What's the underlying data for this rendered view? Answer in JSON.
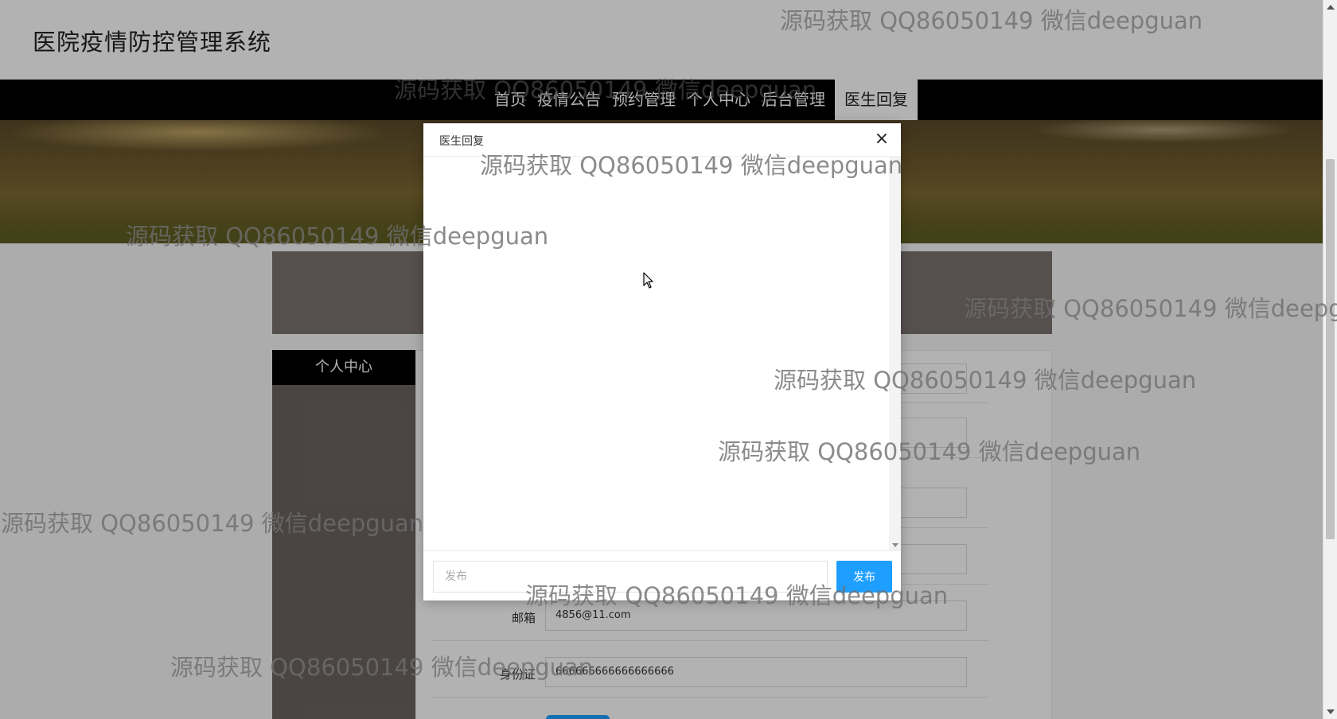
{
  "site": {
    "title": "医院疫情防控管理系统"
  },
  "nav": {
    "items": [
      {
        "label": "首页"
      },
      {
        "label": "疫情公告"
      },
      {
        "label": "预约管理"
      },
      {
        "label": "个人中心"
      },
      {
        "label": "后台管理"
      },
      {
        "label": "医生回复",
        "active": true
      }
    ]
  },
  "sidebar": {
    "title": "个人中心"
  },
  "form": {
    "email_label": "邮箱",
    "email_value": "4856@11.com",
    "idcard_label": "身份证",
    "idcard_value": "666666666666666666"
  },
  "modal": {
    "title": "医生回复",
    "close_glyph": "×",
    "input_placeholder": "发布",
    "publish_label": "发布"
  },
  "watermark": {
    "text": "源码获取 QQ86050149 微信deepguan"
  },
  "colors": {
    "accent": "#1e9fff",
    "nav_bg": "#000000"
  }
}
